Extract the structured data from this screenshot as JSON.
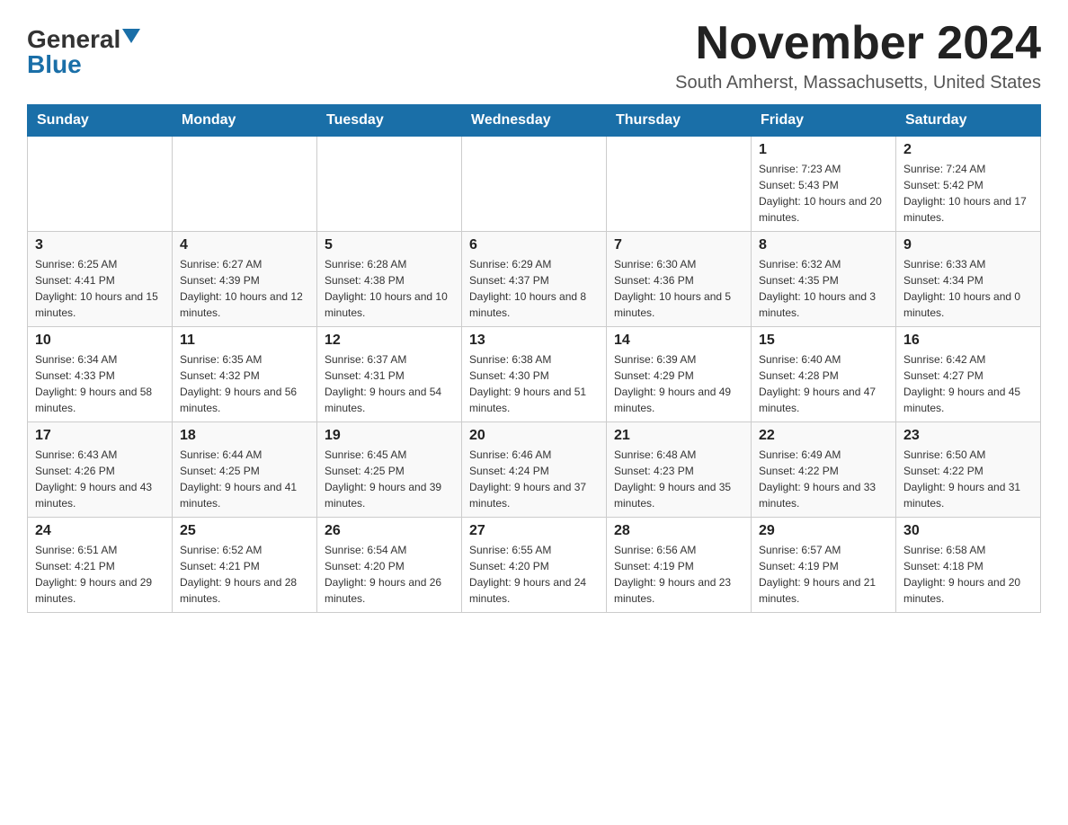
{
  "header": {
    "logo_general": "General",
    "logo_blue": "Blue",
    "month_year": "November 2024",
    "location": "South Amherst, Massachusetts, United States"
  },
  "weekdays": [
    "Sunday",
    "Monday",
    "Tuesday",
    "Wednesday",
    "Thursday",
    "Friday",
    "Saturday"
  ],
  "weeks": [
    {
      "days": [
        {
          "num": "",
          "info": ""
        },
        {
          "num": "",
          "info": ""
        },
        {
          "num": "",
          "info": ""
        },
        {
          "num": "",
          "info": ""
        },
        {
          "num": "",
          "info": ""
        },
        {
          "num": "1",
          "info": "Sunrise: 7:23 AM\nSunset: 5:43 PM\nDaylight: 10 hours and 20 minutes."
        },
        {
          "num": "2",
          "info": "Sunrise: 7:24 AM\nSunset: 5:42 PM\nDaylight: 10 hours and 17 minutes."
        }
      ]
    },
    {
      "days": [
        {
          "num": "3",
          "info": "Sunrise: 6:25 AM\nSunset: 4:41 PM\nDaylight: 10 hours and 15 minutes."
        },
        {
          "num": "4",
          "info": "Sunrise: 6:27 AM\nSunset: 4:39 PM\nDaylight: 10 hours and 12 minutes."
        },
        {
          "num": "5",
          "info": "Sunrise: 6:28 AM\nSunset: 4:38 PM\nDaylight: 10 hours and 10 minutes."
        },
        {
          "num": "6",
          "info": "Sunrise: 6:29 AM\nSunset: 4:37 PM\nDaylight: 10 hours and 8 minutes."
        },
        {
          "num": "7",
          "info": "Sunrise: 6:30 AM\nSunset: 4:36 PM\nDaylight: 10 hours and 5 minutes."
        },
        {
          "num": "8",
          "info": "Sunrise: 6:32 AM\nSunset: 4:35 PM\nDaylight: 10 hours and 3 minutes."
        },
        {
          "num": "9",
          "info": "Sunrise: 6:33 AM\nSunset: 4:34 PM\nDaylight: 10 hours and 0 minutes."
        }
      ]
    },
    {
      "days": [
        {
          "num": "10",
          "info": "Sunrise: 6:34 AM\nSunset: 4:33 PM\nDaylight: 9 hours and 58 minutes."
        },
        {
          "num": "11",
          "info": "Sunrise: 6:35 AM\nSunset: 4:32 PM\nDaylight: 9 hours and 56 minutes."
        },
        {
          "num": "12",
          "info": "Sunrise: 6:37 AM\nSunset: 4:31 PM\nDaylight: 9 hours and 54 minutes."
        },
        {
          "num": "13",
          "info": "Sunrise: 6:38 AM\nSunset: 4:30 PM\nDaylight: 9 hours and 51 minutes."
        },
        {
          "num": "14",
          "info": "Sunrise: 6:39 AM\nSunset: 4:29 PM\nDaylight: 9 hours and 49 minutes."
        },
        {
          "num": "15",
          "info": "Sunrise: 6:40 AM\nSunset: 4:28 PM\nDaylight: 9 hours and 47 minutes."
        },
        {
          "num": "16",
          "info": "Sunrise: 6:42 AM\nSunset: 4:27 PM\nDaylight: 9 hours and 45 minutes."
        }
      ]
    },
    {
      "days": [
        {
          "num": "17",
          "info": "Sunrise: 6:43 AM\nSunset: 4:26 PM\nDaylight: 9 hours and 43 minutes."
        },
        {
          "num": "18",
          "info": "Sunrise: 6:44 AM\nSunset: 4:25 PM\nDaylight: 9 hours and 41 minutes."
        },
        {
          "num": "19",
          "info": "Sunrise: 6:45 AM\nSunset: 4:25 PM\nDaylight: 9 hours and 39 minutes."
        },
        {
          "num": "20",
          "info": "Sunrise: 6:46 AM\nSunset: 4:24 PM\nDaylight: 9 hours and 37 minutes."
        },
        {
          "num": "21",
          "info": "Sunrise: 6:48 AM\nSunset: 4:23 PM\nDaylight: 9 hours and 35 minutes."
        },
        {
          "num": "22",
          "info": "Sunrise: 6:49 AM\nSunset: 4:22 PM\nDaylight: 9 hours and 33 minutes."
        },
        {
          "num": "23",
          "info": "Sunrise: 6:50 AM\nSunset: 4:22 PM\nDaylight: 9 hours and 31 minutes."
        }
      ]
    },
    {
      "days": [
        {
          "num": "24",
          "info": "Sunrise: 6:51 AM\nSunset: 4:21 PM\nDaylight: 9 hours and 29 minutes."
        },
        {
          "num": "25",
          "info": "Sunrise: 6:52 AM\nSunset: 4:21 PM\nDaylight: 9 hours and 28 minutes."
        },
        {
          "num": "26",
          "info": "Sunrise: 6:54 AM\nSunset: 4:20 PM\nDaylight: 9 hours and 26 minutes."
        },
        {
          "num": "27",
          "info": "Sunrise: 6:55 AM\nSunset: 4:20 PM\nDaylight: 9 hours and 24 minutes."
        },
        {
          "num": "28",
          "info": "Sunrise: 6:56 AM\nSunset: 4:19 PM\nDaylight: 9 hours and 23 minutes."
        },
        {
          "num": "29",
          "info": "Sunrise: 6:57 AM\nSunset: 4:19 PM\nDaylight: 9 hours and 21 minutes."
        },
        {
          "num": "30",
          "info": "Sunrise: 6:58 AM\nSunset: 4:18 PM\nDaylight: 9 hours and 20 minutes."
        }
      ]
    }
  ]
}
